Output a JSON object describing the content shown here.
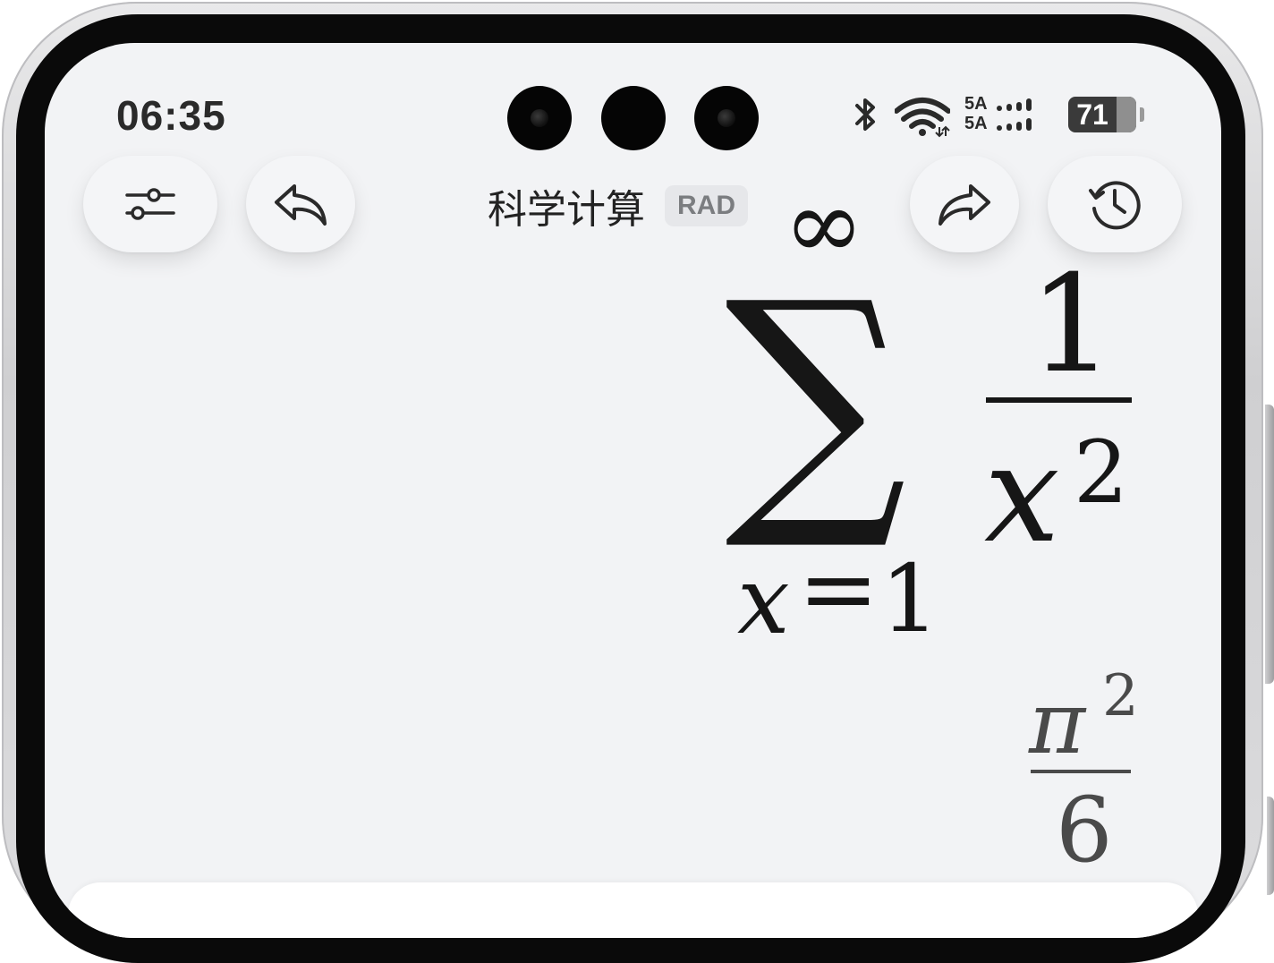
{
  "status_bar": {
    "time": "06:35",
    "signal_1": "5A",
    "signal_2": "5A",
    "battery": "71"
  },
  "header": {
    "title": "科学计算",
    "angle_mode": "RAD",
    "icons": {
      "settings": "sliders-icon",
      "undo": "undo-icon",
      "redo": "redo-icon",
      "history": "history-clock-icon"
    }
  },
  "expression": {
    "upper_limit": "∞",
    "sigma": "∑",
    "sub_var": "x",
    "sub_eq": "=",
    "sub_start": "1",
    "numerator": "1",
    "denominator_base": "x",
    "denominator_exp": "2"
  },
  "result": {
    "numerator_base": "π",
    "numerator_exp": "2",
    "denominator": "6"
  },
  "colors": {
    "screen_bg": "#f2f3f5",
    "text": "#161616",
    "result_text": "#4a4a4a",
    "badge_bg": "#e6e7ea"
  }
}
